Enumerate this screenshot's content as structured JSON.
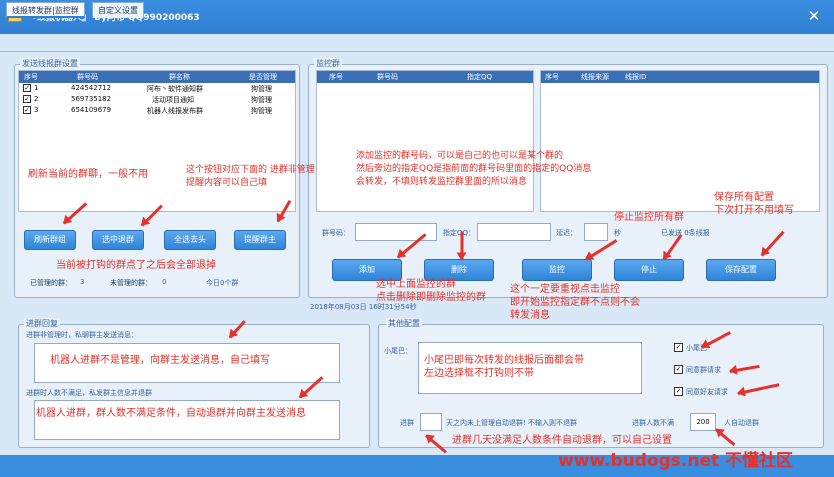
{
  "window": {
    "title": "『线报机器人』 By阿布  QQ990200063",
    "close_glyph": "✕"
  },
  "tabs": [
    {
      "label": "线报转发群|监控群"
    },
    {
      "label": "自定义设置"
    }
  ],
  "send_group": {
    "title": "发送线报群设置",
    "headers": [
      "序号",
      "群号码",
      "群名称",
      "是否管理"
    ],
    "rows": [
      {
        "idx": "1",
        "qq": "424542712",
        "name": "阿布丶软件通知群",
        "admin": "狗管理",
        "checked": "✓"
      },
      {
        "idx": "2",
        "qq": "569735182",
        "name": "活动项目通知",
        "admin": "狗管理",
        "checked": "✓"
      },
      {
        "idx": "3",
        "qq": "654109679",
        "name": "机器人线报发布群",
        "admin": "狗管理",
        "checked": "✓"
      }
    ],
    "buttons": {
      "refresh": "刷新群组",
      "select_exit": "选中退群",
      "select_all": "全选去头",
      "remind": "提醒群主"
    },
    "status": {
      "managed_label": "已管理的群：",
      "managed_value": "3",
      "unmanaged_label": "未管理的群：",
      "unmanaged_value": "0",
      "today": "今日0个群"
    }
  },
  "monitor_group": {
    "title": "监控群",
    "headers_left": [
      "序号",
      "群号码",
      "指定QQ"
    ],
    "headers_right": [
      "序号",
      "线报来源",
      "线报ID"
    ],
    "fields": {
      "group_label": "群号码：",
      "qq_label": "指定QQ：",
      "delay_label": "延迟：",
      "delay_unit": "秒",
      "sent_status": "已发送 0条线报"
    },
    "buttons": {
      "add": "添加",
      "delete": "删除",
      "monitor": "监控",
      "stop": "停止",
      "save": "保存配置"
    },
    "timestamp": "2018年08月03日  16时31分54秒"
  },
  "join_reply": {
    "title": "进群回复",
    "non_admin_label": "进群非管理时，私聊群主发送消息：",
    "non_admin_text": "机器人进群不是管理，向群主发送消息，自己填写",
    "under_label": "进群时人数不满足，私发群主信息并退群",
    "under_text": "机器人进群，群人数不满足条件，自动退群并向群主发送消息"
  },
  "other_config": {
    "title": "其他配置",
    "tail_label": "小尾巴：",
    "tail_text": "小尾巴即每次转发的线报后面都会带\n左边选择框不打钩则不带",
    "checks": [
      {
        "label": "小尾巴",
        "checked": "✓"
      },
      {
        "label": "同意群请求",
        "checked": "✓"
      },
      {
        "label": "同意好友请求",
        "checked": "✓"
      }
    ],
    "exit_row": {
      "prefix": "进群",
      "days_value": "",
      "middle": "天之内未上管理自动退群!  不输入则不退群",
      "min_label": "进群人数不满",
      "min_value": "200",
      "suffix": "人自动退群"
    }
  },
  "annotations": {
    "a1": "刷新当前的群聊，一般不用",
    "a2": "这个按钮对应下面的 进群非管理\n提醒内容可以自己填",
    "a3": "当前被打钩的群点了之后会全部退掉",
    "a4": "添加监控的群号码，可以是自己的也可以是某个群的\n然后旁边的指定QQ是指前面的群号码里面的指定的QQ消息\n会转发，不填则转发监控群里面的所以消息",
    "a5": "停止监控所有群",
    "a6": "保存所有配置\n下次打开不用填写",
    "a7": "选中上面监控的群\n点击删除即删除监控的群",
    "a8": "这个一定要重视点击监控\n即开始监控指定群不点则不会\n转发消息",
    "a9": "进群几天没满足人数条件自动退群，可以自己设置"
  },
  "watermark": "www.budogs.net 不懂社区",
  "colors": {
    "accent": "#2f7fd3",
    "annotation": "#e4312b"
  }
}
